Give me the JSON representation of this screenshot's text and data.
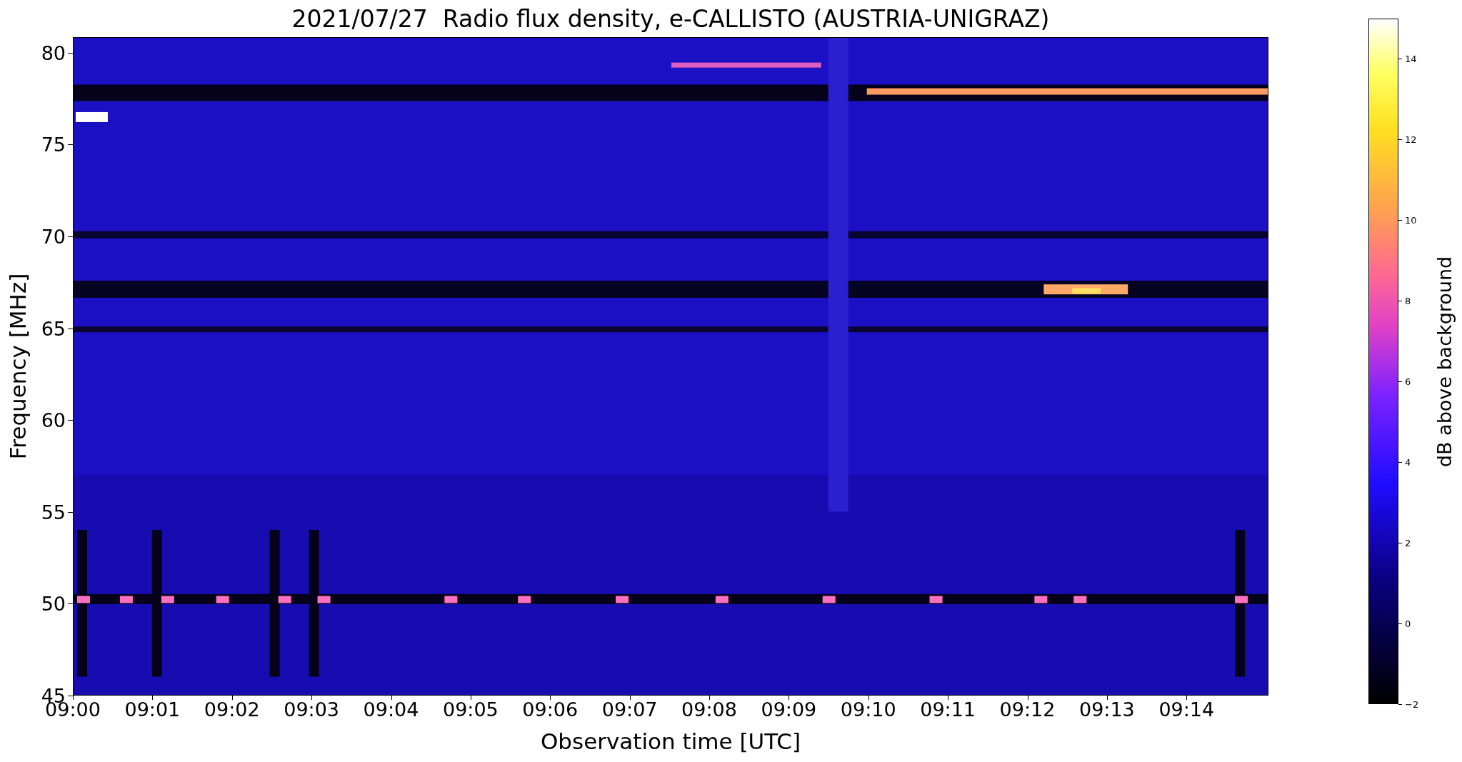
{
  "title": "2021/07/27  Radio flux density, e-CALLISTO (AUSTRIA-UNIGRAZ)",
  "y_axis": {
    "label": "Frequency [MHz]",
    "ticks": [
      "80",
      "75",
      "70",
      "65",
      "60",
      "55",
      "50",
      "45"
    ]
  },
  "x_axis": {
    "label": "Observation time [UTC]",
    "ticks": [
      "09:00",
      "09:01",
      "09:02",
      "09:03",
      "09:04",
      "09:05",
      "09:06",
      "09:07",
      "09:08",
      "09:09",
      "09:10",
      "09:11",
      "09:12",
      "09:13",
      "09:14"
    ]
  },
  "colorbar": {
    "label": "dB above background",
    "ticks": [
      "14",
      "12",
      "10",
      "8",
      "6",
      "4",
      "2",
      "0",
      "−2"
    ]
  }
}
